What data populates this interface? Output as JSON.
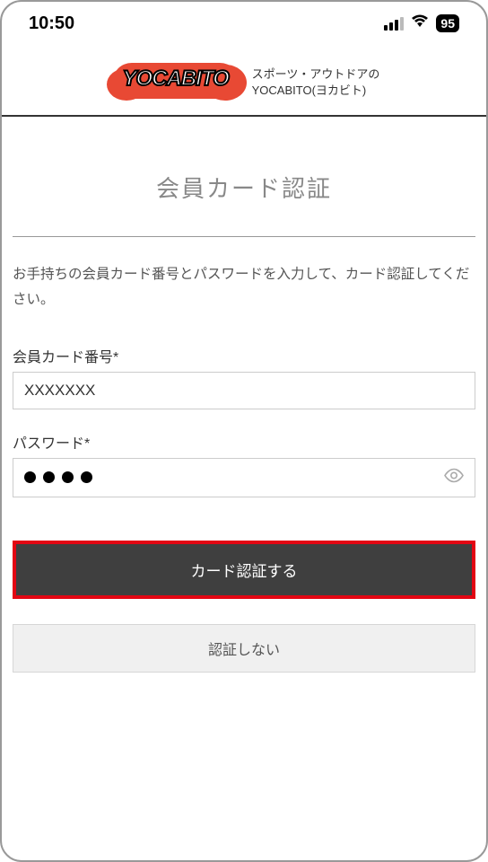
{
  "status": {
    "time": "10:50",
    "battery": "95"
  },
  "brand": {
    "name": "YOCABITO",
    "tagline_line1": "スポーツ・アウトドアの",
    "tagline_line2": "YOCABITO(ヨカビト)"
  },
  "page": {
    "title": "会員カード認証",
    "instructions": "お手持ちの会員カード番号とパスワードを入力して、カード認証してください。"
  },
  "form": {
    "card_label": "会員カード番号*",
    "card_value": "XXXXXXX",
    "password_label": "パスワード*",
    "password_value": "••••",
    "submit_label": "カード認証する",
    "skip_label": "認証しない"
  }
}
